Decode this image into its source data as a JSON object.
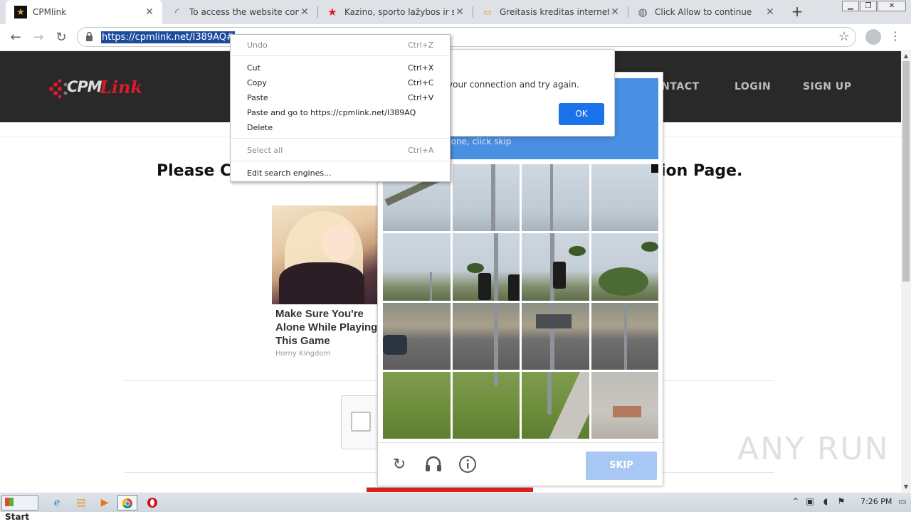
{
  "browser": {
    "tabs": [
      {
        "title": "CPMlink",
        "favicon": "star-icon",
        "active": true
      },
      {
        "title": "To access the website content, pl",
        "favicon": "loading-icon"
      },
      {
        "title": "Kazino, sporto lažybos ir statymų",
        "favicon": "red-star-icon"
      },
      {
        "title": "Greitasis kreditas internetu vos p",
        "favicon": "card-icon"
      },
      {
        "title": "Click Allow to continue",
        "favicon": "globe-icon"
      }
    ],
    "url": "https://cpmlink.net/I389AQ#"
  },
  "site": {
    "logo_cpm": "CPM",
    "logo_link": "Link",
    "nav": [
      "CONTACT",
      "LOGIN",
      "SIGN UP"
    ],
    "headline_left": "Please C",
    "headline_right": "ion Page."
  },
  "ad": {
    "title": "Make Sure You're Alone While Playing This Game",
    "source": "Horny Kingdom"
  },
  "captcha": {
    "header_text": "none, click skip",
    "skip_label": "SKIP"
  },
  "alert": {
    "message": "your connection and try again.",
    "ok_label": "OK"
  },
  "context_menu": {
    "items": [
      {
        "label": "Undo",
        "shortcut": "Ctrl+Z",
        "disabled": true
      },
      {
        "label": "Cut",
        "shortcut": "Ctrl+X"
      },
      {
        "label": "Copy",
        "shortcut": "Ctrl+C"
      },
      {
        "label": "Paste",
        "shortcut": "Ctrl+V"
      },
      {
        "label": "Paste and go to https://cpmlink.net/I389AQ",
        "shortcut": ""
      },
      {
        "label": "Delete",
        "shortcut": ""
      },
      {
        "label": "Select all",
        "shortcut": "Ctrl+A",
        "disabled": true
      },
      {
        "label": "Edit search engines...",
        "shortcut": ""
      }
    ]
  },
  "taskbar": {
    "start_label": "Start",
    "clock": "7:26 PM"
  },
  "watermark": "ANY RUN",
  "colors": {
    "header_bg": "#292929",
    "accent_blue": "#4a90e2",
    "ok_blue": "#1a73e8",
    "logo_red": "#e0192a"
  }
}
